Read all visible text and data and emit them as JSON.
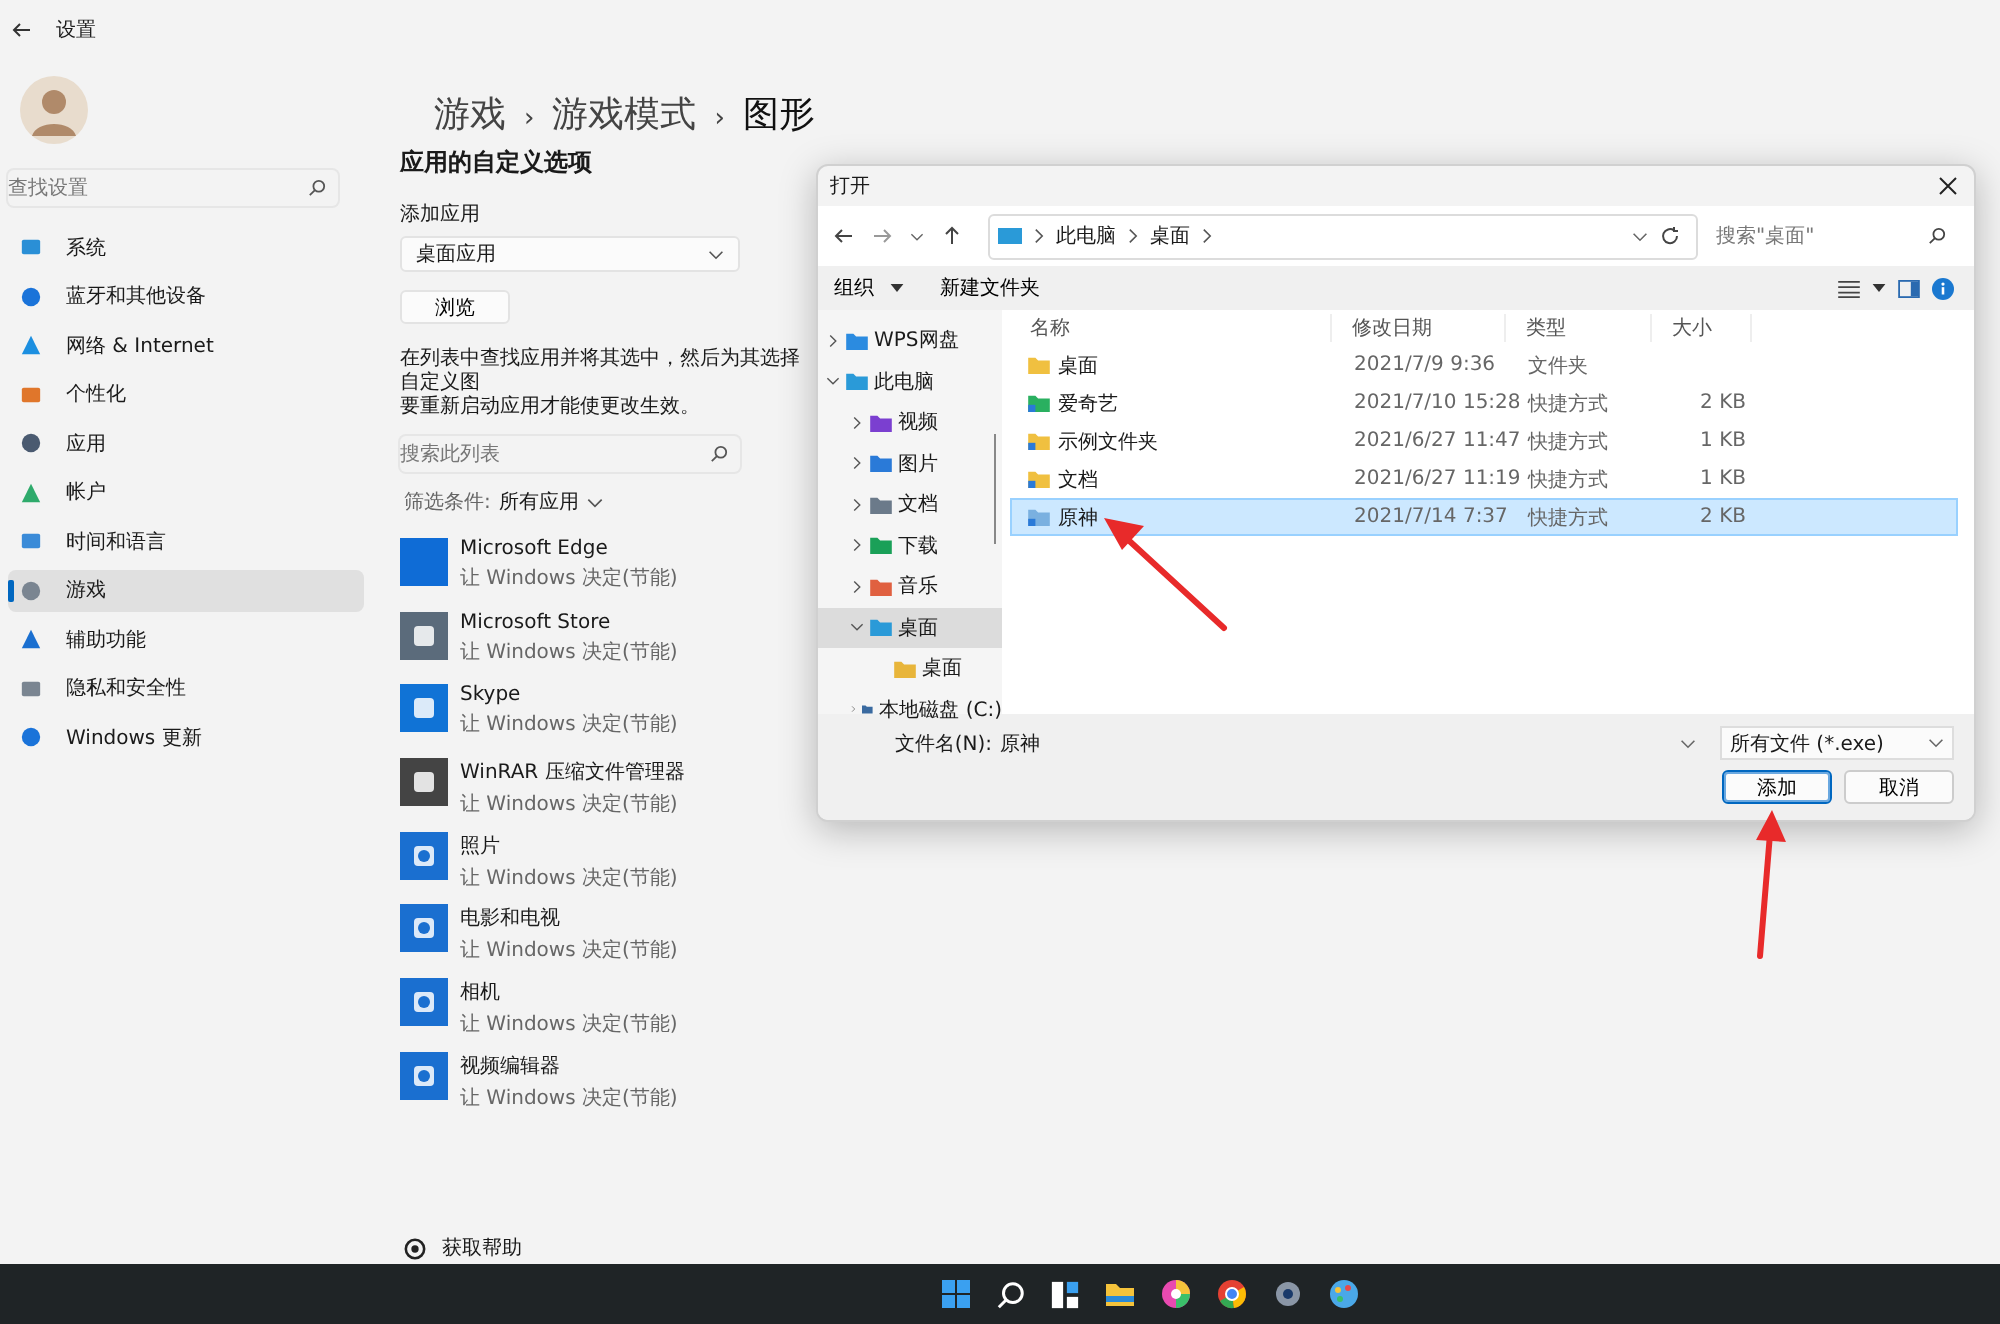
{
  "settings_window": {
    "title": "设置"
  },
  "sidebar": {
    "search": {
      "placeholder": "查找设置"
    },
    "items": [
      {
        "label": "系统",
        "selected": false
      },
      {
        "label": "蓝牙和其他设备",
        "selected": false
      },
      {
        "label": "网络 & Internet",
        "selected": false
      },
      {
        "label": "个性化",
        "selected": false
      },
      {
        "label": "应用",
        "selected": false
      },
      {
        "label": "帐户",
        "selected": false
      },
      {
        "label": "时间和语言",
        "selected": false
      },
      {
        "label": "游戏",
        "selected": true
      },
      {
        "label": "辅助功能",
        "selected": false
      },
      {
        "label": "隐私和安全性",
        "selected": false
      },
      {
        "label": "Windows 更新",
        "selected": false
      }
    ]
  },
  "breadcrumb": [
    "游戏",
    "›",
    "游戏模式",
    "›",
    "图形"
  ],
  "section_title": "应用的自定义选项",
  "add_app": {
    "label": "添加应用",
    "dropdown": "桌面应用",
    "browse_button": "浏览"
  },
  "description": [
    "在列表中查找应用并将其选中，然后为其选择自定义图",
    "要重新启动应用才能使更改生效。"
  ],
  "list_search": {
    "placeholder": "搜索此列表"
  },
  "filter": {
    "label": "筛选条件:",
    "value": "所有应用"
  },
  "apps": [
    {
      "name": "Microsoft Edge",
      "setting": "让 Windows 决定(节能)"
    },
    {
      "name": "Microsoft Store",
      "setting": "让 Windows 决定(节能)"
    },
    {
      "name": "Skype",
      "setting": "让 Windows 决定(节能)"
    },
    {
      "name": "WinRAR 压缩文件管理器",
      "setting": "让 Windows 决定(节能)"
    },
    {
      "name": "照片",
      "setting": "让 Windows 决定(节能)"
    },
    {
      "name": "电影和电视",
      "setting": "让 Windows 决定(节能)"
    },
    {
      "name": "相机",
      "setting": "让 Windows 决定(节能)"
    },
    {
      "name": "视频编辑器",
      "setting": "让 Windows 决定(节能)"
    }
  ],
  "help_link": "获取帮助",
  "dialog": {
    "title": "打开",
    "address": [
      "此电脑",
      "桌面"
    ],
    "search": {
      "placeholder": "搜索\"桌面\""
    },
    "toolbar": {
      "organize": "组织",
      "new_folder": "新建文件夹"
    },
    "tree": [
      {
        "label": "WPS网盘",
        "expanded": false,
        "selected": false
      },
      {
        "label": "此电脑",
        "expanded": true,
        "selected": false,
        "children": [
          {
            "label": "视频",
            "expanded": false,
            "selected": false
          },
          {
            "label": "图片",
            "expanded": false,
            "selected": false
          },
          {
            "label": "文档",
            "expanded": false,
            "selected": false
          },
          {
            "label": "下载",
            "expanded": false,
            "selected": false
          },
          {
            "label": "音乐",
            "expanded": false,
            "selected": false
          },
          {
            "label": "桌面",
            "expanded": true,
            "selected": true,
            "children": [
              {
                "label": "桌面",
                "selected": false
              }
            ]
          },
          {
            "label": "本地磁盘 (C:)",
            "expanded": false,
            "selected": false
          }
        ]
      }
    ],
    "columns": [
      "名称",
      "修改日期",
      "类型",
      "大小"
    ],
    "files": [
      {
        "name": "桌面",
        "date": "2021/7/9 9:36",
        "type": "文件夹",
        "selected": false
      },
      {
        "name": "爱奇艺",
        "date": "2021/7/10 15:28",
        "type": "快捷方式",
        "size": "2 KB",
        "selected": false
      },
      {
        "name": "示例文件夹",
        "date": "2021/6/27 11:47",
        "type": "快捷方式",
        "size": "1 KB",
        "selected": false
      },
      {
        "name": "文档",
        "date": "2021/6/27 11:19",
        "type": "快捷方式",
        "size": "1 KB",
        "selected": false
      },
      {
        "name": "原神",
        "date": "2021/7/14 7:37",
        "type": "快捷方式",
        "size": "2 KB",
        "selected": true
      }
    ],
    "filename_label": "文件名(N):",
    "filename": "原神",
    "filetype": "所有文件 (*.exe)",
    "buttons": [
      {
        "label": "添加",
        "kind": "primary"
      },
      {
        "label": "取消",
        "kind": "secondary"
      }
    ]
  }
}
